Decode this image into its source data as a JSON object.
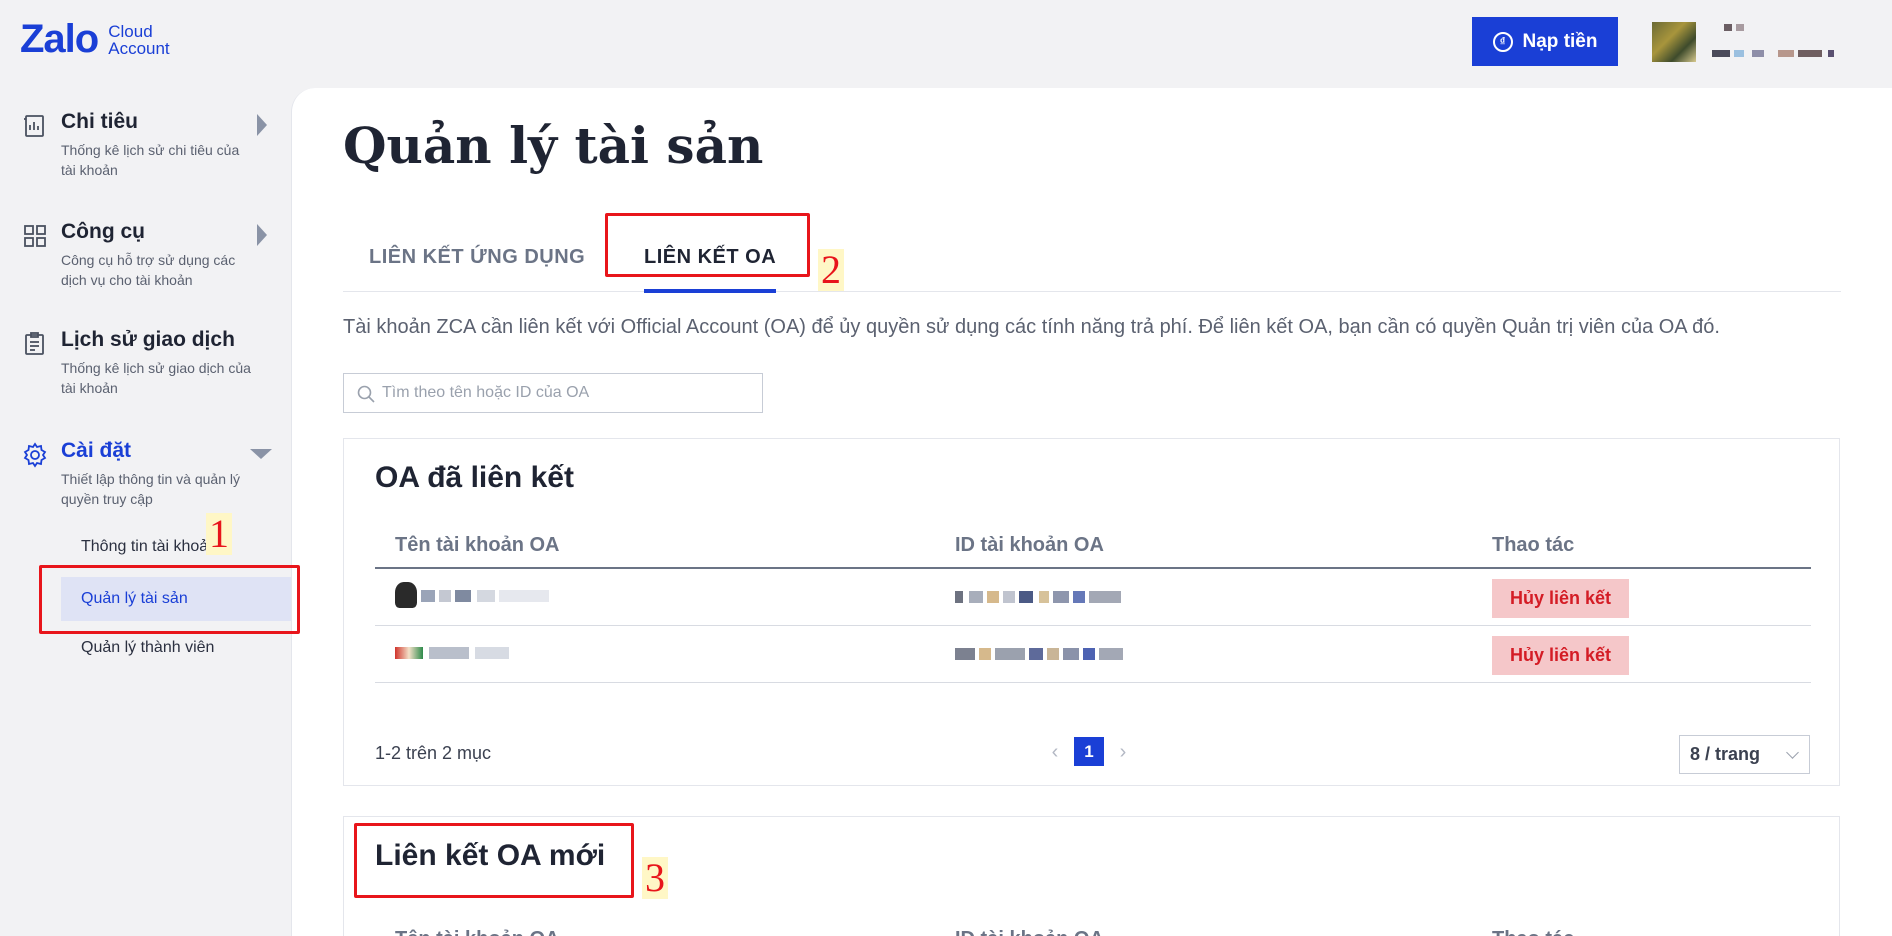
{
  "header": {
    "logo_main": "Zalo",
    "logo_sub_line1": "Cloud",
    "logo_sub_line2": "Account",
    "topup_label": "Nạp tiền"
  },
  "sidebar": {
    "groups": [
      {
        "title": "Chi tiêu",
        "desc": "Thống kê lịch sử chi tiêu của tài khoản",
        "icon": "report-icon"
      },
      {
        "title": "Công cụ",
        "desc": "Công cụ hỗ trợ sử dụng các dịch vụ cho tài khoản",
        "icon": "grid-icon"
      },
      {
        "title": "Lịch sử giao dịch",
        "desc": "Thống kê lịch sử giao dịch của tài khoản",
        "icon": "clipboard-icon"
      },
      {
        "title": "Cài đặt",
        "desc": "Thiết lập thông tin và quản lý quyền truy cập",
        "icon": "gear-icon"
      }
    ],
    "sub_items": [
      {
        "label": "Thông tin tài khoản",
        "selected": false
      },
      {
        "label": "Quản lý tài sản",
        "selected": true
      },
      {
        "label": "Quản lý thành viên",
        "selected": false
      }
    ]
  },
  "annotations": [
    "1",
    "2",
    "3"
  ],
  "main": {
    "title": "Quản lý tài sản",
    "tabs": [
      {
        "label": "LIÊN KẾT ỨNG DỤNG",
        "active": false
      },
      {
        "label": "LIÊN KẾT OA",
        "active": true
      }
    ],
    "info": "Tài khoản ZCA cần liên kết với Official Account (OA) để ủy quyền sử dụng các tính năng trả phí. Để liên kết OA, bạn cần có quyền Quản trị viên của OA đó.",
    "search_placeholder": "Tìm theo tên hoặc ID của OA",
    "linked": {
      "title": "OA đã liên kết",
      "columns": [
        "Tên tài khoản OA",
        "ID tài khoản OA",
        "Thao tác"
      ],
      "action_label": "Hủy liên kết",
      "row_count": 2,
      "summary": "1-2 trên 2 mục",
      "current_page": "1",
      "per_page": "8 / trang"
    },
    "new_link": {
      "title": "Liên kết OA mới",
      "columns": [
        "Tên tài khoản OA",
        "ID tài khoản OA",
        "Thao tác"
      ]
    }
  },
  "colors": {
    "brand": "#1a3fd6",
    "danger_bg": "#f5c7c9",
    "danger_text": "#d41c25",
    "annotation": "#e8151b"
  }
}
